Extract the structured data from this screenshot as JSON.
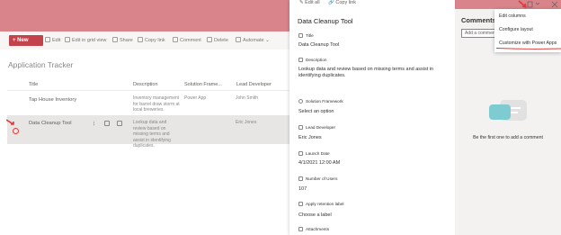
{
  "commandbar": {
    "new_label": "New",
    "edit_label": "Edit",
    "edit_grid_label": "Edit in grid view",
    "share_label": "Share",
    "copy_link_label": "Copy link",
    "comment_label": "Comment",
    "delete_label": "Delete",
    "automate_label": "Automate"
  },
  "list": {
    "title": "Application Tracker",
    "columns": [
      "Title",
      "Description",
      "Solution Frame...",
      "Lead Developer"
    ],
    "rows": [
      {
        "title": "Tap House Inventory",
        "description": "Inventory management for barrel draw storm at local breweries.",
        "framework": "Power App",
        "developer": "John Smith"
      },
      {
        "title": "Data Cleanup Tool",
        "description": "Lookup data and review based on missing terms and assist in identifying duplicates.",
        "framework": "",
        "developer": "Eric Jones"
      }
    ]
  },
  "panel": {
    "edit_all_label": "Edit all",
    "copy_link_label": "Copy link",
    "title": "Data Cleanup Tool",
    "fields": [
      {
        "label": "Title",
        "value": "Data Cleanup Tool"
      },
      {
        "label": "Description",
        "value": "Lookup data and review based on missing terms and assist in identifying duplicates."
      },
      {
        "label": "Solution Framework",
        "value": "Select an option"
      },
      {
        "label": "Lead Developer",
        "value": "Eric Jones"
      },
      {
        "label": "Launch Date",
        "value": "4/1/2021 12:00 AM"
      },
      {
        "label": "Number of Users",
        "value": "107"
      },
      {
        "label": "Apply retention label",
        "value": "Choose a label"
      },
      {
        "label": "Attachments",
        "value": ""
      }
    ]
  },
  "comments": {
    "title": "Comments",
    "placeholder": "Add a comment",
    "empty_text": "Be the first one to add a comment"
  },
  "menu": {
    "items": [
      "Edit columns",
      "Configure layout",
      "Customize with Power Apps"
    ]
  },
  "colors": {
    "banner": "#d8848a",
    "accent": "#c3434c",
    "annotation_red": "#e03a3a"
  }
}
